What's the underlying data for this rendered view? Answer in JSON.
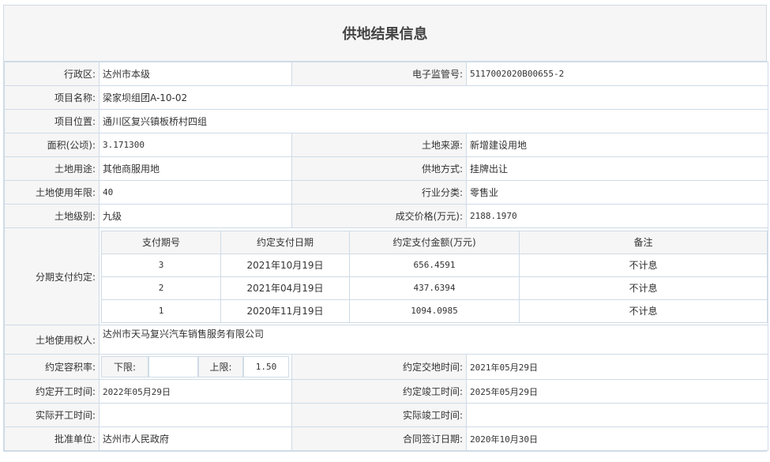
{
  "title": "供地结果信息",
  "rows": {
    "admin_region": {
      "label": "行政区:",
      "value": "达州市本级"
    },
    "e_supervision_no": {
      "label": "电子监管号:",
      "value": "5117002020B00655-2"
    },
    "project_name": {
      "label": "项目名称:",
      "value": "梁家坝组团A-10-02"
    },
    "project_location": {
      "label": "项目位置:",
      "value": "通川区复兴镇板桥村四组"
    },
    "area": {
      "label": "面积(公顷):",
      "value": "3.171300"
    },
    "land_source": {
      "label": "土地来源:",
      "value": "新增建设用地"
    },
    "land_use": {
      "label": "土地用途:",
      "value": "其他商服用地"
    },
    "supply_method": {
      "label": "供地方式:",
      "value": "挂牌出让"
    },
    "use_years": {
      "label": "土地使用年限:",
      "value": "40"
    },
    "industry": {
      "label": "行业分类:",
      "value": "零售业"
    },
    "land_grade": {
      "label": "土地级别:",
      "value": "九级"
    },
    "deal_price": {
      "label": "成交价格(万元):",
      "value": "2188.1970"
    },
    "installment_label": "分期支付约定:",
    "land_user": {
      "label": "土地使用权人:",
      "value": "达州市天马复兴汽车销售服务有限公司"
    },
    "far": {
      "label": "约定容积率:",
      "lower_label": "下限:",
      "lower_value": "",
      "upper_label": "上限:",
      "upper_value": "1.50"
    },
    "agreed_delivery": {
      "label": "约定交地时间:",
      "value": "2021年05月29日"
    },
    "agreed_start": {
      "label": "约定开工时间:",
      "value": "2022年05月29日"
    },
    "agreed_completion": {
      "label": "约定竣工时间:",
      "value": "2025年05月29日"
    },
    "actual_start": {
      "label": "实际开工时间:",
      "value": ""
    },
    "actual_completion": {
      "label": "实际竣工时间:",
      "value": ""
    },
    "approval_unit": {
      "label": "批准单位:",
      "value": "达州市人民政府"
    },
    "contract_date": {
      "label": "合同签订日期:",
      "value": "2020年10月30日"
    }
  },
  "installments": {
    "headers": [
      "支付期号",
      "约定支付日期",
      "约定支付金额(万元)",
      "备注"
    ],
    "items": [
      {
        "no": "3",
        "date": "2021年10月19日",
        "amount": "656.4591",
        "note": "不计息"
      },
      {
        "no": "2",
        "date": "2021年04月19日",
        "amount": "437.6394",
        "note": "不计息"
      },
      {
        "no": "1",
        "date": "2020年11月19日",
        "amount": "1094.0985",
        "note": "不计息"
      }
    ]
  }
}
